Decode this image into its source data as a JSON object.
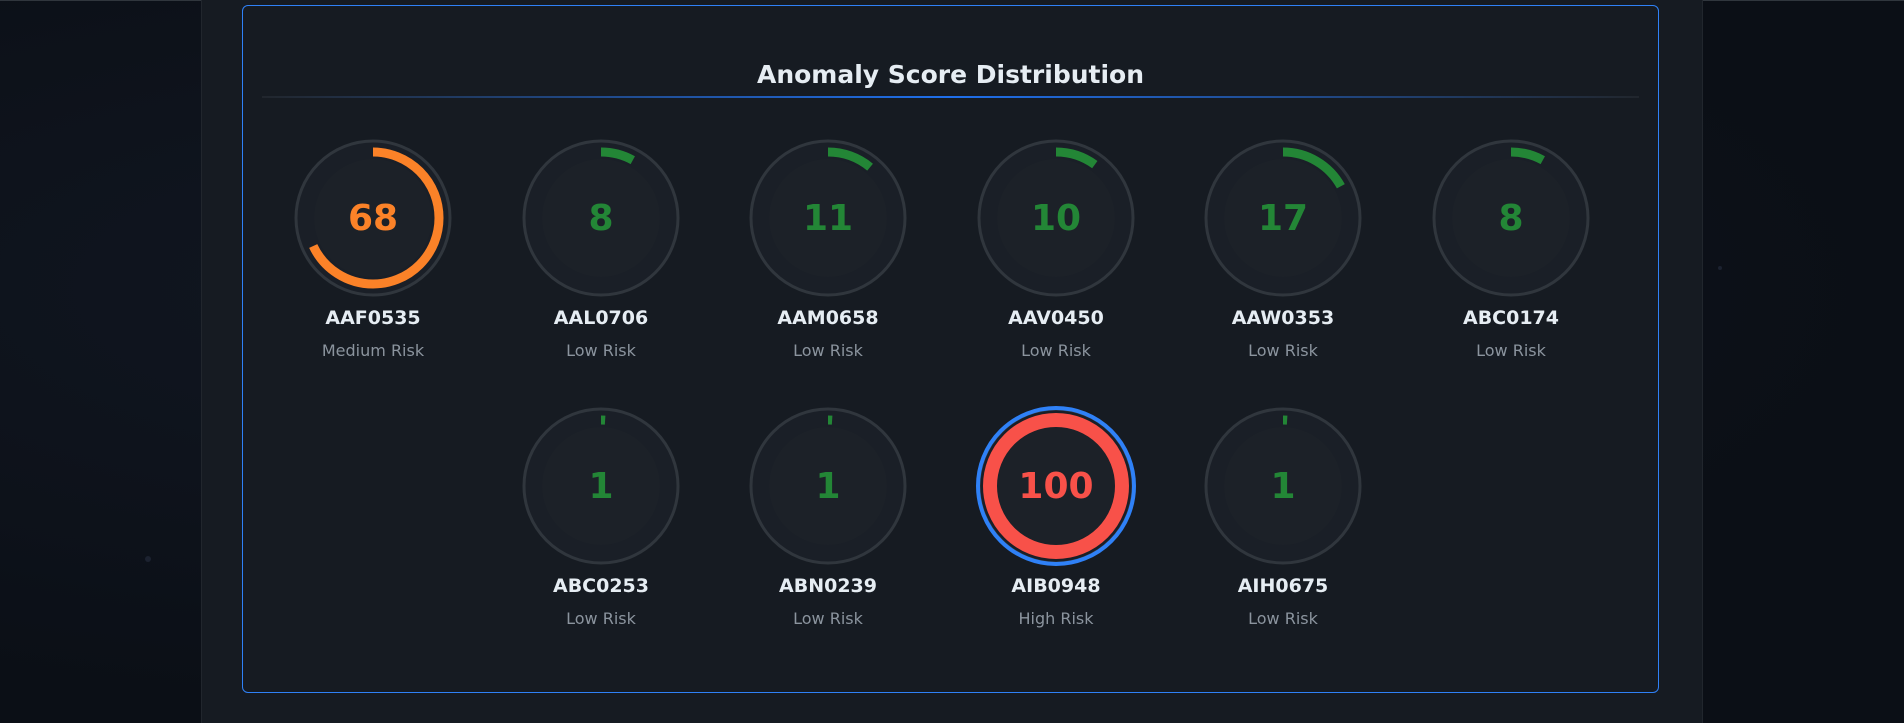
{
  "panel": {
    "title": "Anomaly Score Distribution"
  },
  "colors": {
    "low": "#238636",
    "medium": "#fb8228",
    "high": "#f85149",
    "selected_ring": "#2f81f7",
    "track": "#30363d",
    "inner": "#1c2128"
  },
  "gauges": [
    {
      "id": "AAF0535",
      "score": 68,
      "score_label": "68",
      "risk": "Medium Risk",
      "level": "medium",
      "selected": false
    },
    {
      "id": "AAL0706",
      "score": 8,
      "score_label": "8",
      "risk": "Low Risk",
      "level": "low",
      "selected": false
    },
    {
      "id": "AAM0658",
      "score": 11,
      "score_label": "11",
      "risk": "Low Risk",
      "level": "low",
      "selected": false
    },
    {
      "id": "AAV0450",
      "score": 10,
      "score_label": "10",
      "risk": "Low Risk",
      "level": "low",
      "selected": false
    },
    {
      "id": "AAW0353",
      "score": 17,
      "score_label": "17",
      "risk": "Low Risk",
      "level": "low",
      "selected": false
    },
    {
      "id": "ABC0174",
      "score": 8,
      "score_label": "8",
      "risk": "Low Risk",
      "level": "low",
      "selected": false
    },
    {
      "id": "ABC0253",
      "score": 1,
      "score_label": "1",
      "risk": "Low Risk",
      "level": "low",
      "selected": false
    },
    {
      "id": "ABN0239",
      "score": 1,
      "score_label": "1",
      "risk": "Low Risk",
      "level": "low",
      "selected": false
    },
    {
      "id": "AIB0948",
      "score": 100,
      "score_label": "100",
      "risk": "High Risk",
      "level": "high",
      "selected": true
    },
    {
      "id": "AIH0675",
      "score": 1,
      "score_label": "1",
      "risk": "Low Risk",
      "level": "low",
      "selected": false
    }
  ]
}
